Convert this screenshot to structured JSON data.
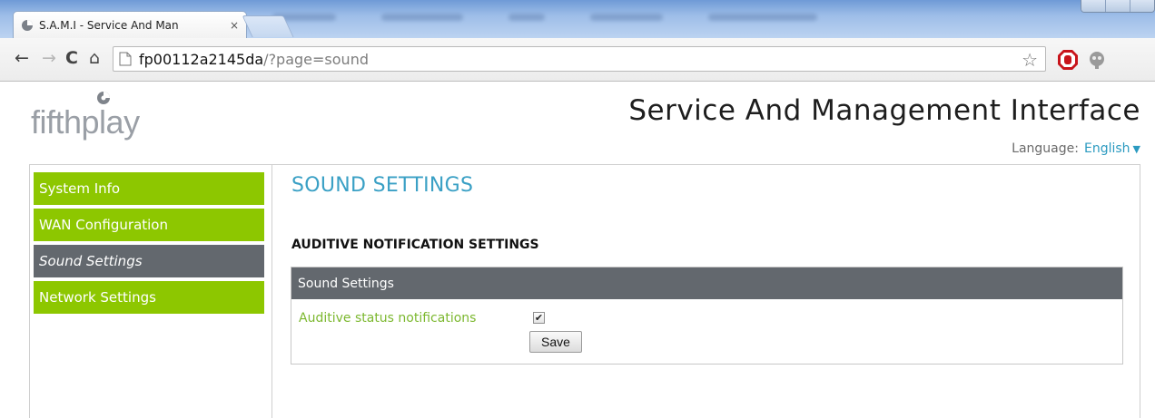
{
  "browser": {
    "tab_title": "S.A.M.I - Service And Man",
    "tab_close": "×",
    "url_host": "fp00112a2145da",
    "url_path": "/?page=sound",
    "nav": {
      "back": "←",
      "forward": "→",
      "reload": "C",
      "home": "⌂"
    },
    "star": "☆"
  },
  "page": {
    "logo_text": "fifthplay",
    "site_title": "Service And Management Interface",
    "language_label": "Language:",
    "language_value": "English",
    "language_caret": "▼"
  },
  "sidebar": {
    "items": [
      {
        "label": "System Info",
        "active": false
      },
      {
        "label": "WAN Configuration",
        "active": false
      },
      {
        "label": "Sound Settings",
        "active": true
      },
      {
        "label": "Network Settings",
        "active": false
      }
    ]
  },
  "main": {
    "section_title": "SOUND SETTINGS",
    "subsection_title": "AUDITIVE NOTIFICATION SETTINGS",
    "box_header": "Sound Settings",
    "option_label": "Auditive status notifications",
    "option_checked": true,
    "checkmark": "✔",
    "save_label": "Save"
  },
  "colors": {
    "accent_green": "#8dc700",
    "active_grey": "#63686e",
    "title_blue": "#3aa0c5",
    "label_green": "#7cb82f"
  }
}
